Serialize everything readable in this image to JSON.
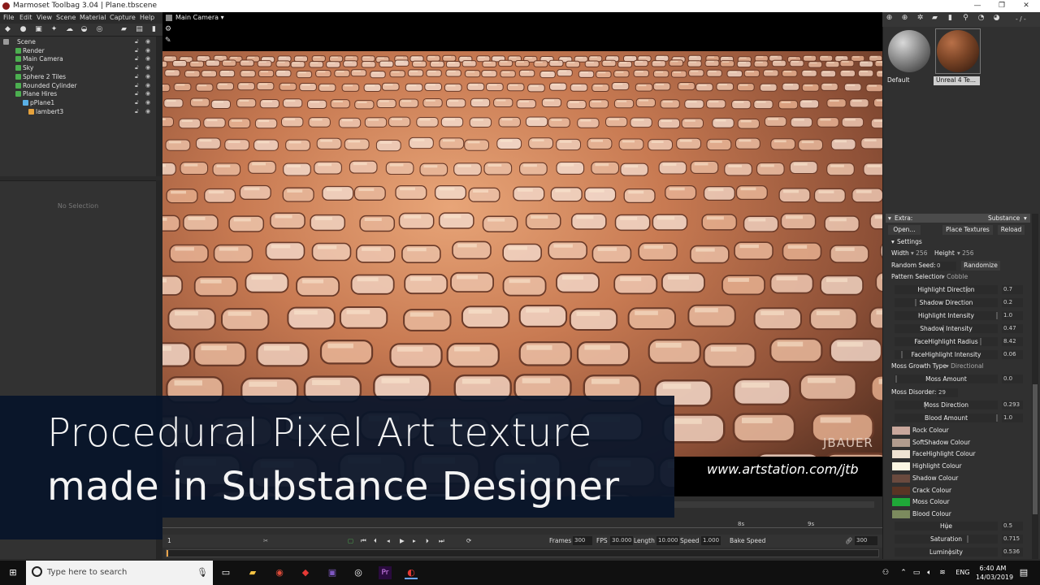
{
  "window": {
    "title": "Marmoset Toolbag 3.04  |  Plane.tbscene",
    "min": "—",
    "restore": "❐",
    "close": "✕"
  },
  "menu": [
    "File",
    "Edit",
    "View",
    "Scene",
    "Material",
    "Capture",
    "Help"
  ],
  "outliner": {
    "items": [
      {
        "label": "Scene",
        "depth": 0,
        "color": "#9a9a9a"
      },
      {
        "label": "Render",
        "depth": 1,
        "color": "#4caf50"
      },
      {
        "label": "Main Camera",
        "depth": 1,
        "color": "#4caf50"
      },
      {
        "label": "Sky",
        "depth": 1,
        "color": "#4caf50"
      },
      {
        "label": "Sphere 2 Tiles",
        "depth": 1,
        "color": "#4caf50"
      },
      {
        "label": "Rounded Cylinder",
        "depth": 1,
        "color": "#4caf50"
      },
      {
        "label": "Plane Hires",
        "depth": 1,
        "color": "#4caf50"
      },
      {
        "label": "pPlane1",
        "depth": 2,
        "color": "#5ab0e6"
      },
      {
        "label": "lambert3",
        "depth": 3,
        "color": "#e6a23c"
      }
    ]
  },
  "properties": {
    "empty_text": "No Selection"
  },
  "viewport": {
    "camera_label": "Main Camera",
    "watermark": "JBAUER",
    "url": "www.artstation.com/jtb"
  },
  "overlay": {
    "line1": "Procedural Pixel Art texture",
    "line2": "made in Substance Designer"
  },
  "timeline": {
    "frame_start": "1",
    "marker_8s": "8s",
    "marker_9s": "9s",
    "frames_label": "Frames",
    "frames_value": "300",
    "fps_label": "FPS",
    "fps_value": "30.000",
    "length_label": "Length",
    "length_value": "10.000",
    "speed_label": "Speed",
    "speed_value": "1.000",
    "bake_label": "Bake Speed",
    "end_frame": "300"
  },
  "materials": {
    "page_indicator": "- / -",
    "items": [
      {
        "label": "Default",
        "color": "#8a8a8a",
        "selected": false
      },
      {
        "label": "Unreal 4 Te...",
        "color": "#7a4426",
        "selected": true
      }
    ]
  },
  "extra": {
    "header_left": "Extra:",
    "header_right": "Substance",
    "open_button": "Open...",
    "place_button": "Place Textures",
    "reload_button": "Reload",
    "settings_label": "Settings",
    "width_label": "Width",
    "width_value": "256",
    "height_label": "Height",
    "height_value": "256",
    "seed_label": "Random Seed:",
    "seed_value": "0",
    "randomize_button": "Randomize",
    "pattern_label": "Pattern Selection",
    "pattern_value": "Cobble",
    "sliders_a": [
      {
        "name": "Highlight Direction",
        "value": "0.7",
        "level": 0.7
      },
      {
        "name": "Shadow Direction",
        "value": "0.2",
        "level": 0.2
      },
      {
        "name": "Highlight Intensity",
        "value": "1.0",
        "level": 1.0
      },
      {
        "name": "Shadow Intensity",
        "value": "0.47",
        "level": 0.47
      },
      {
        "name": "FaceHighlight Radius",
        "value": "8.42",
        "level": 0.84
      },
      {
        "name": "FaceHighlight Intensity",
        "value": "0.06",
        "level": 0.06
      }
    ],
    "moss_type_label": "Moss Growth Type",
    "moss_type_value": "Directional",
    "moss_amount": {
      "name": "Moss Amount",
      "value": "0.0",
      "level": 0.0
    },
    "moss_disorder_label": "Moss Disorder:",
    "moss_disorder_value": "29",
    "sliders_b": [
      {
        "name": "Moss Direction",
        "value": "0.293",
        "level": 0.293
      },
      {
        "name": "Blood Amount",
        "value": "1.0",
        "level": 1.0
      }
    ],
    "colours": [
      {
        "name": "Rock Colour",
        "color": "#c9a79c"
      },
      {
        "name": "SoftShadow Colour",
        "color": "#b19c8e"
      },
      {
        "name": "FaceHighlight Colour",
        "color": "#efe2d2"
      },
      {
        "name": "Highlight Colour",
        "color": "#fbf6e2"
      },
      {
        "name": "Shadow Colour",
        "color": "#6a4a3e"
      },
      {
        "name": "Crack Colour",
        "color": "#5a3424"
      },
      {
        "name": "Moss Colour",
        "color": "#1fa838"
      },
      {
        "name": "Blood Colour",
        "color": "#7c8a5e"
      }
    ],
    "sliders_c": [
      {
        "name": "Hue",
        "value": "0.5",
        "level": 0.5
      },
      {
        "name": "Saturation",
        "value": "0.715",
        "level": 0.715
      },
      {
        "name": "Luminosity",
        "value": "0.536",
        "level": 0.536
      }
    ]
  },
  "taskbar": {
    "search_placeholder": "Type here to search",
    "lang": "ENG",
    "time": "6:40 AM",
    "date": "14/03/2019"
  }
}
